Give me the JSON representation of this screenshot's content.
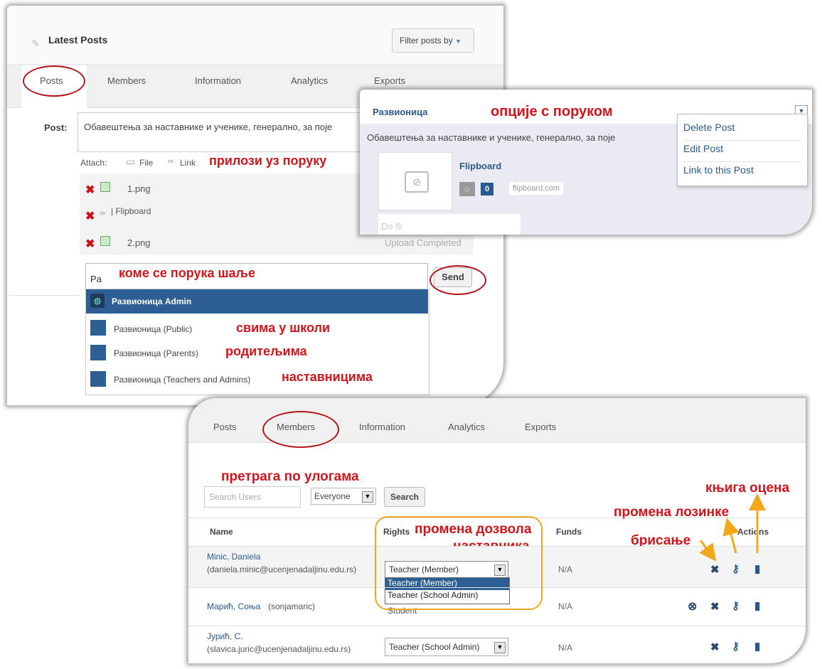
{
  "panel1": {
    "title": "Latest Posts",
    "filter_button": "Filter posts by",
    "tabs": [
      "Posts",
      "Members",
      "Information",
      "Analytics",
      "Exports"
    ],
    "post_label": "Post:",
    "post_text": "Обавештења за наставнике и ученике, генерално, за поје",
    "attach_label": "Attach:",
    "attach_file": "File",
    "attach_link": "Link",
    "attachments": [
      "1.png",
      "| Flipboard",
      "2.png"
    ],
    "upload_status": "Upload Completed",
    "recipient_value": "Pa",
    "send_button": "Send",
    "recipients": [
      "Развионица Admin",
      "Развионица (Public)",
      "Развионица (Parents)",
      "Развионица (Teachers and Admins)"
    ]
  },
  "panel2": {
    "group_name": "Развионица",
    "post_text": "Обавештења за наставнике и ученике, генерално, за поје",
    "link_title": "Flipboard",
    "count": "0",
    "domain": "flipboard.com",
    "partial_text": "Do fli",
    "menu": [
      "Delete Post",
      "Edit Post",
      "Link to this Post"
    ]
  },
  "panel3": {
    "tabs": [
      "Posts",
      "Members",
      "Information",
      "Analytics",
      "Exports"
    ],
    "search_placeholder": "Search Users",
    "role_filter": "Everyone",
    "search_button": "Search",
    "headers": {
      "name": "Name",
      "rights": "Rights",
      "funds": "Funds",
      "actions": "Actions"
    },
    "rows": [
      {
        "name": "Minic, Daniela",
        "email": "(daniela.minic@ucenjenadaljinu.edu.rs)",
        "rights": "Teacher (Member)",
        "funds": "N/A"
      },
      {
        "name": "Марић, Соња",
        "email": "(sonjamaric)",
        "rights": "Student",
        "funds": "N/A"
      },
      {
        "name": "Јурић, С.",
        "email": "(slavica.juric@ucenjenadaljinu.edu.rs)",
        "rights": "Teacher (School Admin)",
        "funds": "N/A"
      }
    ],
    "rights_options": [
      "Teacher (Member)",
      "Teacher (School Admin)"
    ]
  },
  "annotations": {
    "message_options": "опције с поруком",
    "attachments": "прилози уз поруку",
    "recipient": "коме се порука шаље",
    "all_school": "свима у школи",
    "parents": "родитељима",
    "teachers": "наставницима",
    "role_search": "претрага по улогама",
    "gradebook": "књига оцена",
    "password_change": "промена лозинке",
    "delete": "брисање",
    "permission_line1": "промена дозвола",
    "permission_line2": "наставника"
  },
  "colors": {
    "annotation_red": "#d1151b",
    "selected_blue": "#2d5f94",
    "orange_arrow": "#f2a81c",
    "link_blue": "#2a5a8d"
  }
}
